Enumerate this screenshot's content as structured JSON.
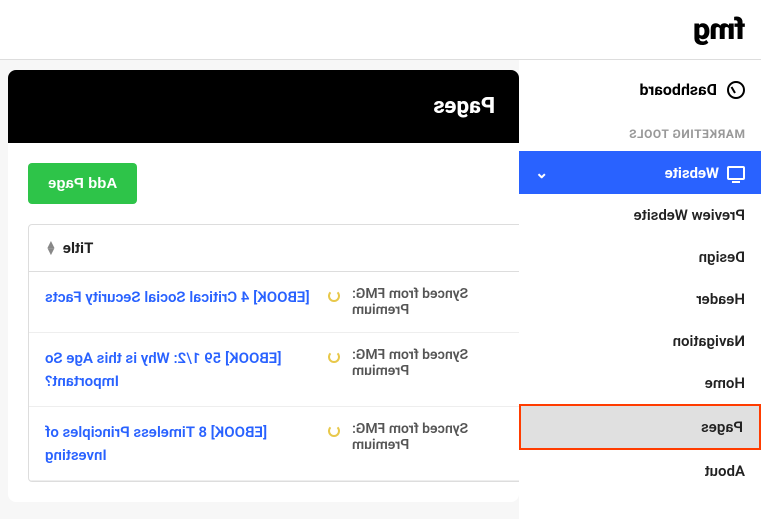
{
  "brand": "fmg",
  "sidebar": {
    "top": {
      "label": "Dashboard"
    },
    "section_label": "MARKETING TOOLS",
    "primary": {
      "label": "Website"
    },
    "subs": [
      {
        "label": "Preview Website"
      },
      {
        "label": "Design"
      },
      {
        "label": "Header"
      },
      {
        "label": "Navigation"
      },
      {
        "label": "Home"
      },
      {
        "label": "Pages",
        "selected": true
      },
      {
        "label": "About"
      }
    ]
  },
  "page": {
    "title": "Pages",
    "add_button": "Add Page",
    "table": {
      "col_title": "Title",
      "rows": [
        {
          "title": "[EBOOK] 4 Critical Social Security Facts",
          "sync": "Synced from FMG: Premium"
        },
        {
          "title": "[EBOOK] 59 1/2: Why is this Age So Important?",
          "sync": "Synced from FMG: Premium"
        },
        {
          "title": "[EBOOK] 8 Timeless Principles of Investing",
          "sync": "Synced from FMG: Premium"
        }
      ]
    }
  }
}
